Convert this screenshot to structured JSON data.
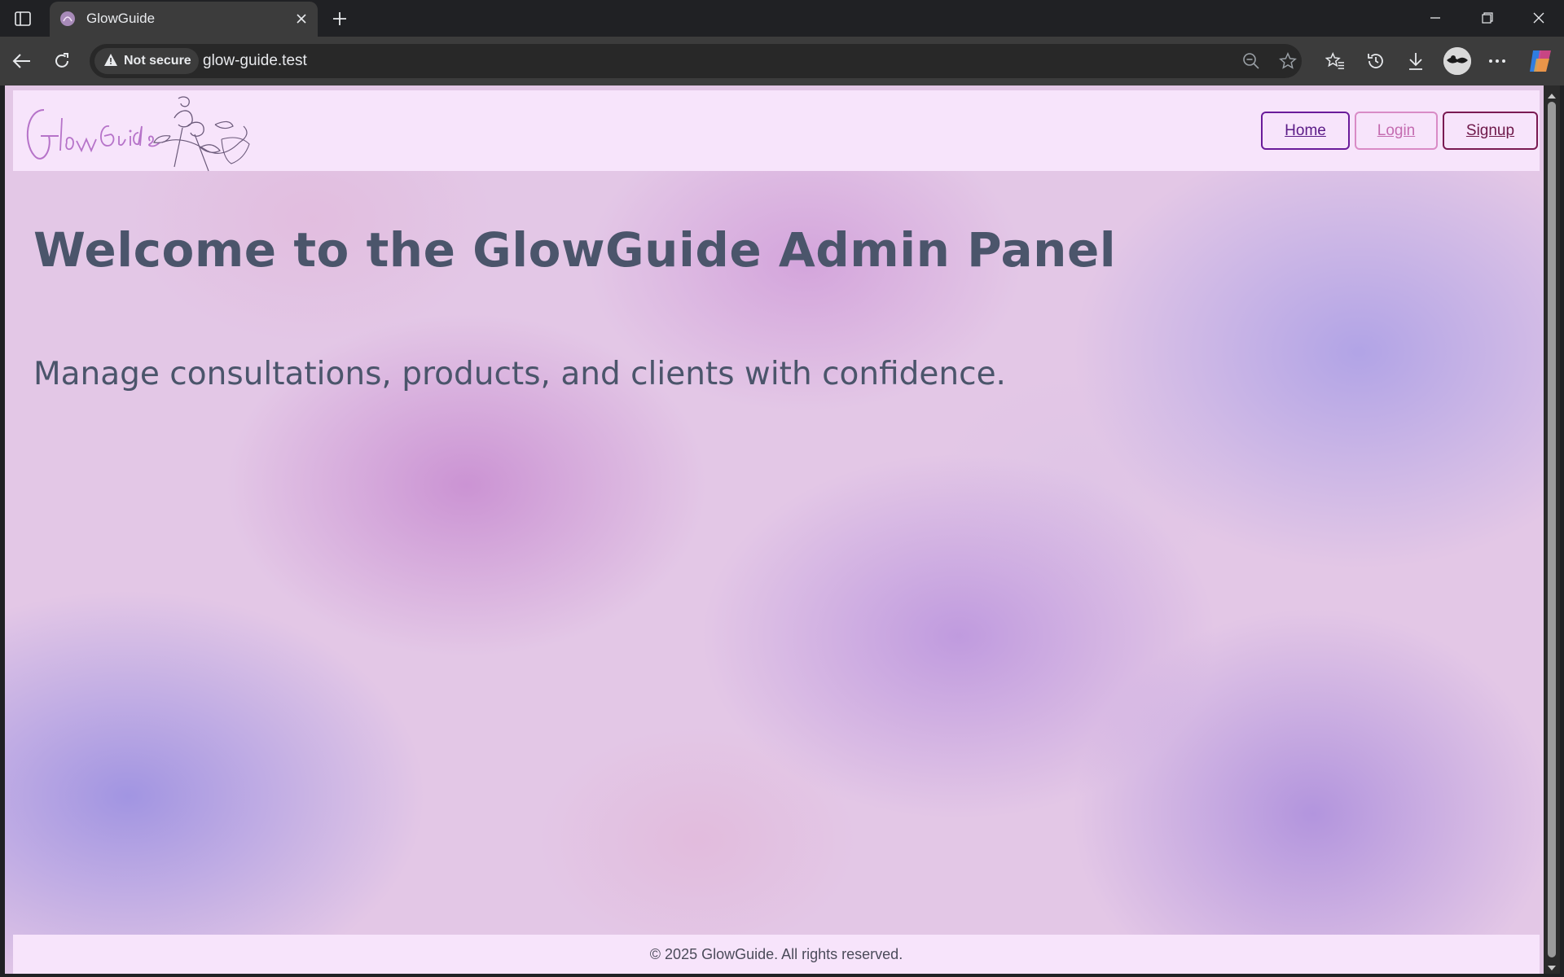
{
  "browser": {
    "tab_title": "GlowGuide",
    "security_label": "Not secure",
    "url": "glow-guide.test"
  },
  "site": {
    "logo_text": "GlowGuide",
    "nav": {
      "home": "Home",
      "login": "Login",
      "signup": "Signup"
    },
    "hero": {
      "title": "Welcome to the GlowGuide Admin Panel",
      "subtitle": "Manage consultations, products, and clients with confidence."
    },
    "footer": "© 2025 GlowGuide. All rights reserved."
  },
  "colors": {
    "header_bg": "#f7e4fb",
    "title_color": "#4b556b",
    "home_border": "#6a1b9a",
    "login_border": "#d98bc6",
    "signup_border": "#7a1a52"
  },
  "icons": [
    "sidebar-icon",
    "favicon-icon",
    "close-icon",
    "plus-icon",
    "minimize-icon",
    "restore-icon",
    "back-icon",
    "reload-icon",
    "warning-icon",
    "zoom-out-icon",
    "star-icon",
    "favorites-icon",
    "history-icon",
    "download-icon",
    "more-icon",
    "copilot-icon"
  ]
}
